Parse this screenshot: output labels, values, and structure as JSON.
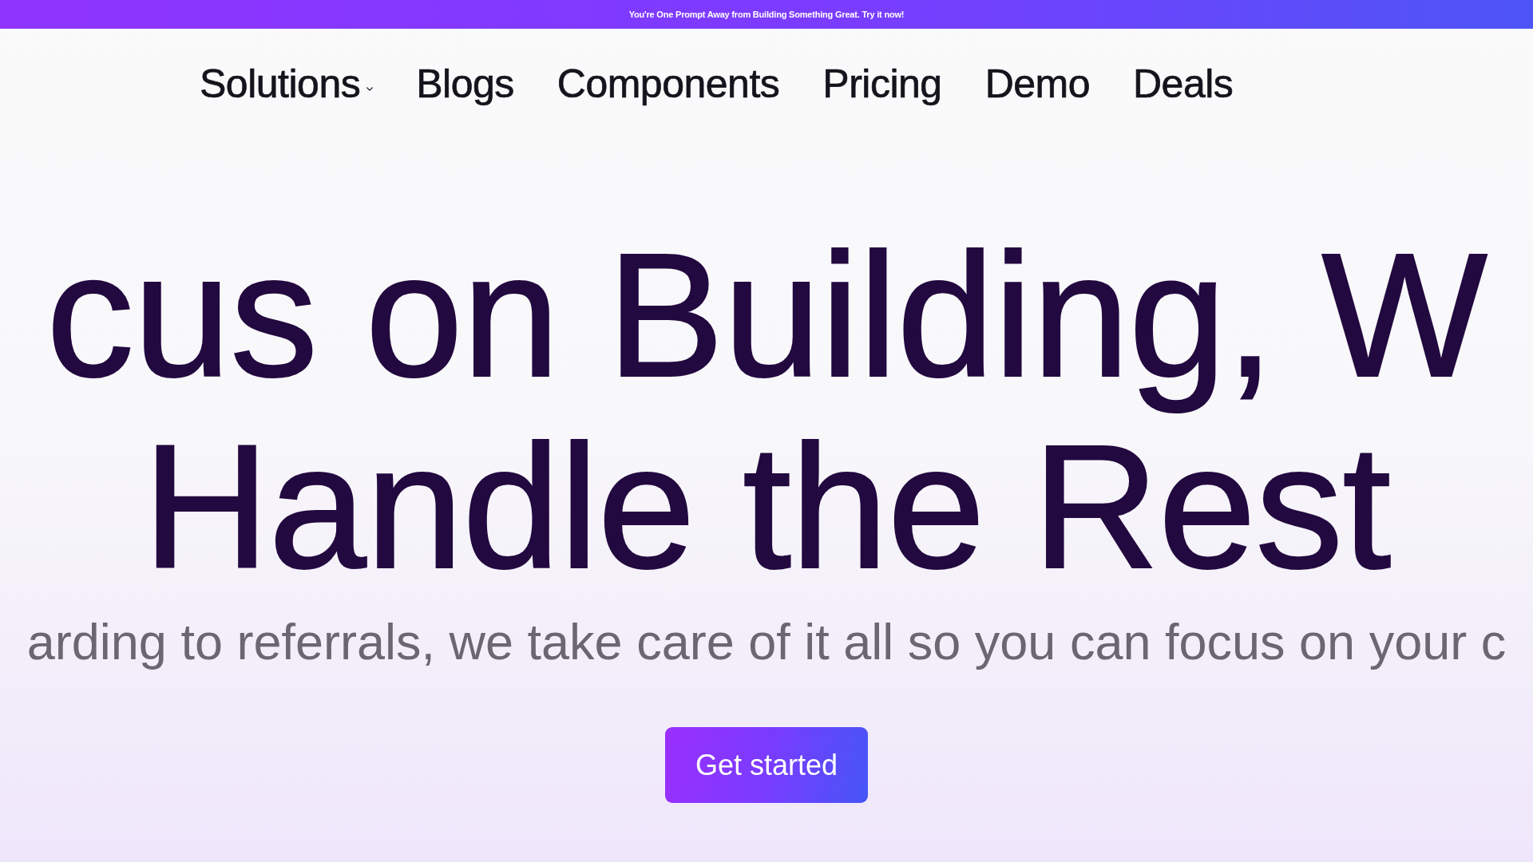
{
  "announcement_bar": {
    "text": "You're One Prompt Away from Building Something Great. Try it now!"
  },
  "nav": {
    "items": [
      {
        "label": "Solutions",
        "kind": "dropdown"
      },
      {
        "label": "Blogs",
        "kind": "link"
      },
      {
        "label": "Components",
        "kind": "link"
      },
      {
        "label": "Pricing",
        "kind": "link"
      },
      {
        "label": "Demo",
        "kind": "link"
      },
      {
        "label": "Deals",
        "kind": "link"
      }
    ]
  },
  "hero": {
    "heading_lines": [
      "cus on Building, W",
      "Handle the Rest"
    ],
    "subtitle": "arding to referrals, we take care of it all so you can focus on your c",
    "cta": "Get started"
  }
}
